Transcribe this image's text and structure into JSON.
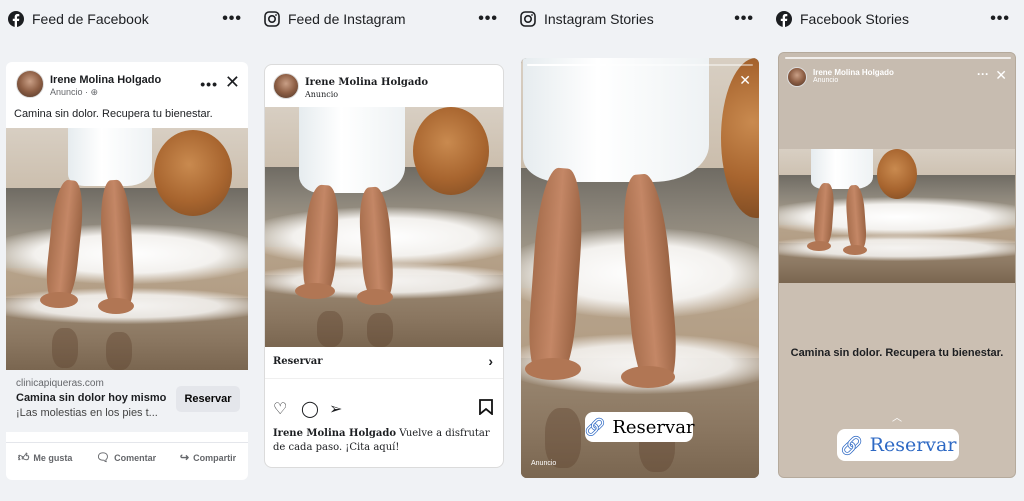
{
  "columns": [
    {
      "title": "Feed de Facebook",
      "icon": "facebook-icon",
      "more": "•••"
    },
    {
      "title": "Feed de Instagram",
      "icon": "instagram-icon",
      "more": "•••"
    },
    {
      "title": "Instagram Stories",
      "icon": "instagram-icon",
      "more": "•••"
    },
    {
      "title": "Facebook Stories",
      "icon": "facebook-icon",
      "more": "•••"
    }
  ],
  "advertiser": "Irene Molina Holgado",
  "sponsored": "Anuncio",
  "fb_feed": {
    "primary_text": "Camina sin dolor. Recupera tu bienestar.",
    "domain": "clinicapiqueras.com",
    "headline": "Camina sin dolor hoy mismo",
    "description": "¡Las molestias en los pies t...",
    "cta": "Reservar",
    "actions": [
      "Me gusta",
      "Comentar",
      "Compartir"
    ]
  },
  "ig_feed": {
    "cta": "Reservar",
    "caption_name": "Irene Molina Holgado",
    "caption_text": "Vuelve a disfrutar de cada paso. ¡Cita aquí!"
  },
  "ig_story": {
    "cta": "Reservar",
    "label": "Anuncio",
    "progress": 0.35
  },
  "fb_story": {
    "text": "Camina sin dolor. Recupera tu bienestar.",
    "cta": "Reservar"
  },
  "colors": {
    "facebook_blue": "#1877f2",
    "link_blue": "#2e69c4",
    "background": "#f0f2f5"
  }
}
